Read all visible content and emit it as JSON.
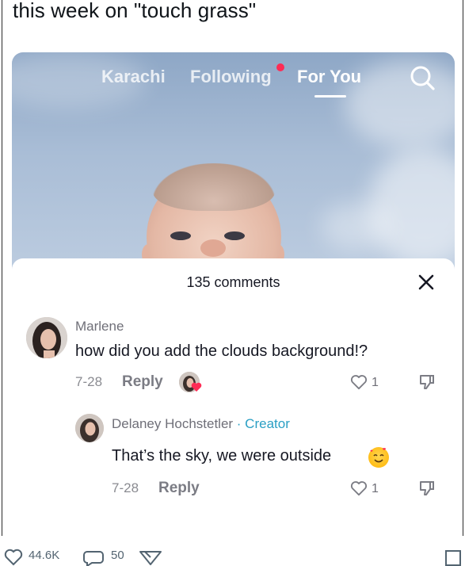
{
  "post": {
    "text": "this week on \"touch grass\""
  },
  "video": {
    "nav": {
      "karachi": "Karachi",
      "following": "Following",
      "for_you": "For You"
    }
  },
  "comments_sheet": {
    "title": "135 comments",
    "comments": [
      {
        "username": "Marlene",
        "text": "how did you add the clouds background!?",
        "date": "7-28",
        "reply_label": "Reply",
        "likes": "1"
      },
      {
        "username": "Delaney Hochstetler",
        "creator_label": " · Creator",
        "text": "That’s the sky, we were outside",
        "date": "7-28",
        "reply_label": "Reply",
        "likes": "1"
      }
    ]
  },
  "bottom_bar": {
    "likes": "44.6K",
    "replies": "50"
  },
  "colors": {
    "accent_red": "#fe2c55",
    "creator_blue": "#2a9fc4",
    "text": "#161823"
  }
}
